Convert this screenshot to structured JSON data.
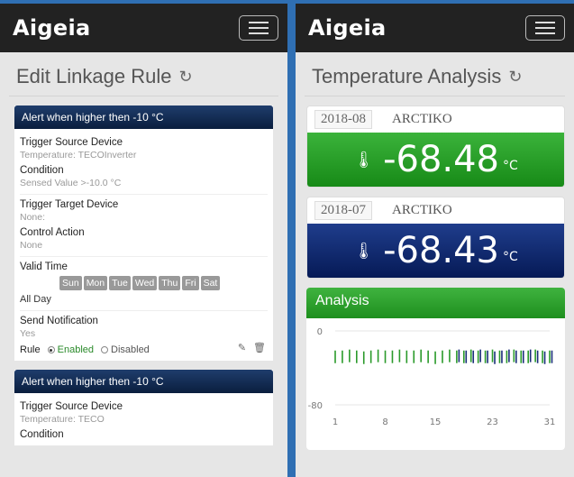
{
  "left": {
    "brand": "Aigeia",
    "page_title": "Edit Linkage Rule",
    "rules": [
      {
        "header": "Alert when higher then -10 °C",
        "trigger_source_label": "Trigger Source Device",
        "trigger_source_value": "Temperature: TECOInverter",
        "condition_label": "Condition",
        "condition_value": "Sensed Value >-10.0   °C",
        "trigger_target_label": "Trigger Target Device",
        "trigger_target_value": "None:",
        "control_action_label": "Control Action",
        "control_action_value": "None",
        "valid_time_label": "Valid Time",
        "days": [
          "Sun",
          "Mon",
          "Tue",
          "Wed",
          "Thu",
          "Fri",
          "Sat"
        ],
        "all_day": "All Day",
        "send_notification_label": "Send Notification",
        "send_notification_value": "Yes",
        "rule_label": "Rule",
        "enabled_label": "Enabled",
        "disabled_label": "Disabled"
      },
      {
        "header": "Alert when higher then -10 °C",
        "trigger_source_label": "Trigger Source Device",
        "trigger_source_value": "Temperature: TECO",
        "condition_label": "Condition"
      }
    ]
  },
  "right": {
    "brand": "Aigeia",
    "page_title": "Temperature Analysis",
    "stats": [
      {
        "date": "2018-08",
        "device": "ARCTIKO",
        "value": "-68.48",
        "unit": "°C",
        "color": "#1e9a1e"
      },
      {
        "date": "2018-07",
        "device": "ARCTIKO",
        "value": "-68.43",
        "unit": "°C",
        "color": "#0a2470"
      }
    ],
    "analysis_title": "Analysis"
  },
  "chart_data": {
    "type": "bar",
    "title": "",
    "xlabel": "",
    "ylabel": "",
    "ylim": [
      -80,
      0
    ],
    "yticks": [
      0,
      -80
    ],
    "xticks": [
      1,
      8,
      15,
      23,
      31
    ],
    "grid": true,
    "series": [
      {
        "color": "#2a9a2a",
        "x": [
          1,
          2,
          3,
          4,
          5,
          6,
          7,
          8,
          9,
          10,
          11,
          12,
          13,
          14,
          15,
          16,
          17,
          18,
          19,
          20,
          21,
          22,
          23,
          24,
          25,
          26,
          27,
          28,
          29,
          30,
          31
        ],
        "values": [
          -28,
          -28,
          -27,
          -28,
          -29,
          -28,
          -27,
          -28,
          -28,
          -27,
          -28,
          -28,
          -27,
          -28,
          -29,
          -28,
          -27,
          -28,
          -28,
          -27,
          -28,
          -28,
          -27,
          -28,
          -28,
          -27,
          -28,
          -28,
          -27,
          -28,
          -28
        ]
      },
      {
        "color": "#1a2e7a",
        "x": [
          18,
          19,
          20,
          21,
          22,
          23,
          24,
          25,
          26,
          27,
          28,
          29,
          30,
          31
        ],
        "values": [
          -27,
          -28,
          -28,
          -27,
          -28,
          -29,
          -28,
          -27,
          -28,
          -28,
          -27,
          -28,
          -29,
          -28
        ]
      }
    ]
  }
}
